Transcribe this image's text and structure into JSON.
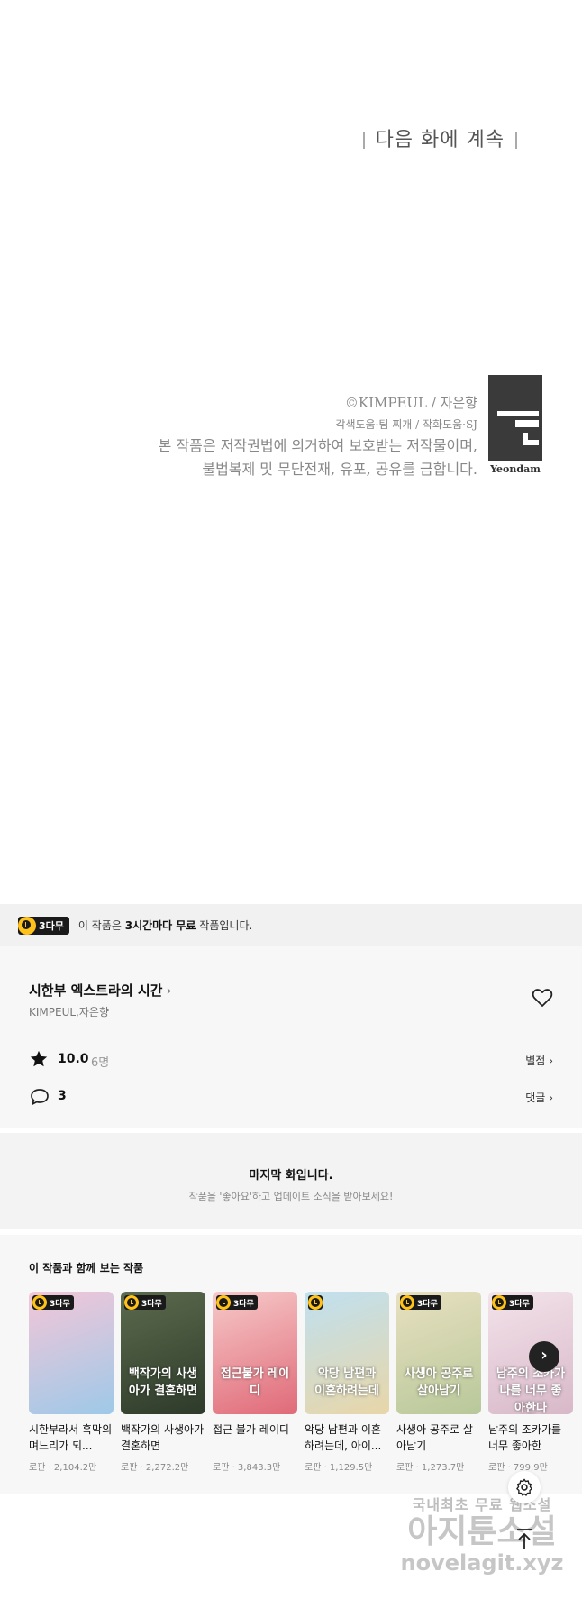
{
  "comic": {
    "next_episode": "다음 화에 계속",
    "copyright": "©KIMPEUL / 자은향",
    "assist": "각색도움·팀 찌개 / 작화도움·SJ",
    "notice_line1": "본 작품은 저작권법에 의거하여 보호받는 저작물이며,",
    "notice_line2": "불법복제 및 무단전재, 유포, 공유를 금합니다.",
    "publisher": "Yeondam"
  },
  "free_notice": {
    "badge": "3다무",
    "prefix": "이 작품은 ",
    "bold": "3시간마다 무료",
    "suffix": " 작품입니다."
  },
  "work": {
    "title": "시한부 엑스트라의 시간",
    "author": "KIMPEUL,자은향",
    "rating": "10.0",
    "raters": "6명",
    "rate_link": "별점",
    "comments": "3",
    "comments_link": "댓글"
  },
  "last_episode": {
    "heading": "마지막 화입니다.",
    "sub": "작품을 '좋아요'하고 업데이트 소식을 받아보세요!"
  },
  "recommendations": {
    "heading": "이 작품과 함께 보는 작품",
    "items": [
      {
        "badge": "3다무",
        "title": "시한부라서 흑막의 며느리가 되...",
        "meta": "로판 · 2,104.2만",
        "colors": [
          "#f3c6d8",
          "#9ec9e8"
        ]
      },
      {
        "badge": "3다무",
        "title": "백작가의 사생아가 결혼하면",
        "meta": "로판 · 2,272.2만",
        "colors": [
          "#5b6b4d",
          "#2e3a2a"
        ],
        "art": "백작가의 사생아가 결혼하면"
      },
      {
        "badge": "3다무",
        "title": "접근 불가 레이디",
        "meta": "로판 · 3,843.3만",
        "colors": [
          "#f6c9c9",
          "#e06a78"
        ],
        "art": "접근불가 레이디"
      },
      {
        "badge": "",
        "title": "악당 남편과 이혼하려는데, 아이...",
        "meta": "로판 · 1,129.5만",
        "colors": [
          "#bfe0f0",
          "#e8d6a8"
        ],
        "art": "악당 남편과 이혼하려는데"
      },
      {
        "badge": "3다무",
        "title": "사생아 공주로 살아남기",
        "meta": "로판 · 1,273.7만",
        "colors": [
          "#e8e0c0",
          "#b8c89a"
        ],
        "art": "사생아 공주로 살아남기"
      },
      {
        "badge": "3다무",
        "title": "남주의 조카가를 너무 좋아한",
        "meta": "로판 · 799.9만",
        "colors": [
          "#f3e3ea",
          "#d8b8c8"
        ],
        "art": "남주의 조카가 나를 너무 좋아한다"
      }
    ]
  },
  "watermark": {
    "line1": "국내최초 무료 웹소설",
    "line2": "아지툰소설",
    "line3": "novelagit.xyz"
  }
}
